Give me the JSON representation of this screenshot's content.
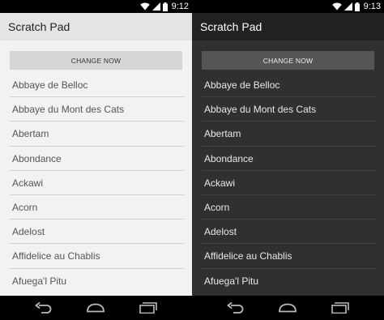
{
  "screens": [
    {
      "theme": "light",
      "status": {
        "time": "9:12"
      },
      "app_title": "Scratch Pad",
      "button_label": "CHANGE NOW",
      "items": [
        "Abbaye de Belloc",
        "Abbaye du Mont des Cats",
        "Abertam",
        "Abondance",
        "Ackawi",
        "Acorn",
        "Adelost",
        "Affidelice au Chablis",
        "Afuega'l Pitu"
      ]
    },
    {
      "theme": "dark",
      "status": {
        "time": "9:13"
      },
      "app_title": "Scratch Pad",
      "button_label": "CHANGE NOW",
      "items": [
        "Abbaye de Belloc",
        "Abbaye du Mont des Cats",
        "Abertam",
        "Abondance",
        "Ackawi",
        "Acorn",
        "Adelost",
        "Affidelice au Chablis",
        "Afuega'l Pitu"
      ]
    }
  ],
  "icons": {
    "status": [
      "wifi-icon",
      "signal-icon",
      "battery-icon"
    ],
    "nav": [
      "back-icon",
      "home-icon",
      "recents-icon"
    ]
  },
  "colors": {
    "light_actionbar": "#e4e4e4",
    "light_background": "#f2f2f2",
    "dark_actionbar": "#212121",
    "dark_background": "#303030"
  }
}
